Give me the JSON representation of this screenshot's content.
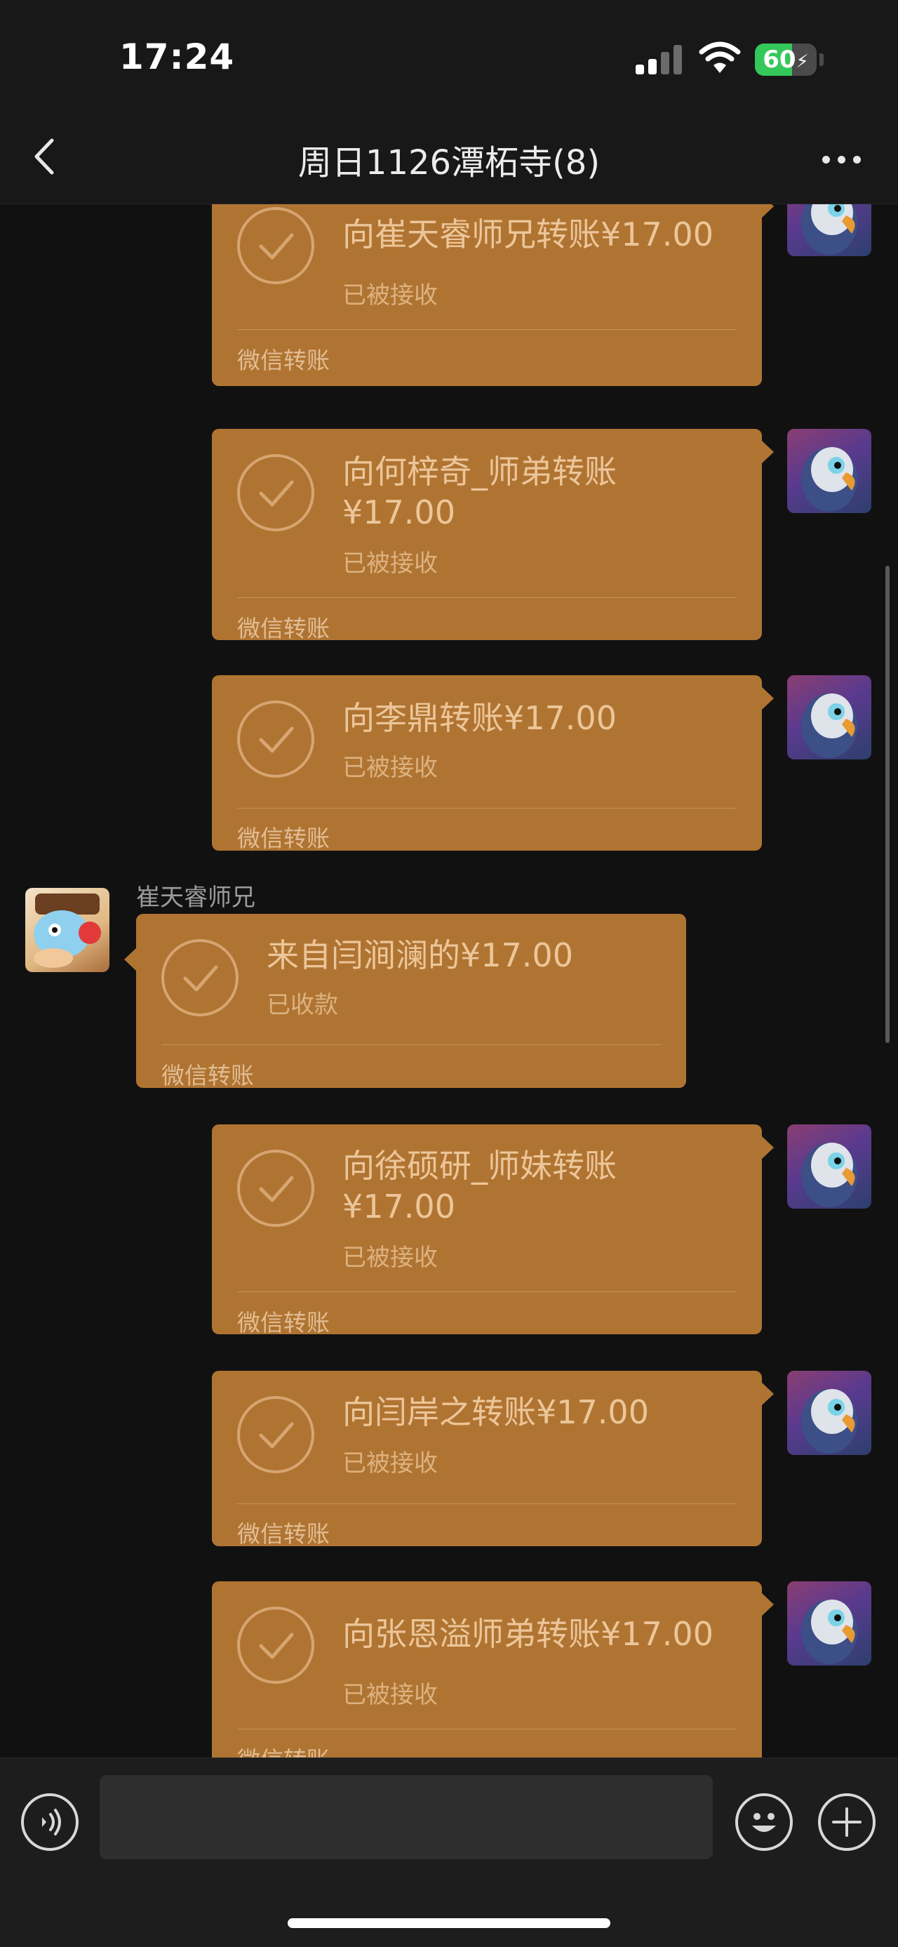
{
  "status_bar": {
    "time": "17:24",
    "battery": "60"
  },
  "nav": {
    "title": "周日1126潭柘寺(8)"
  },
  "messages": [
    {
      "title_line1": "向崔天睿师兄转账¥17.00",
      "title_line2": "",
      "status": "已被接收",
      "footer": "微信转账"
    },
    {
      "title_line1": "向何梓奇_师弟转账",
      "title_line2": "¥17.00",
      "status": "已被接收",
      "footer": "微信转账"
    },
    {
      "title_line1": "向李鼎转账¥17.00",
      "title_line2": "",
      "status": "已被接收",
      "footer": "微信转账"
    },
    {
      "sender_name": "崔天睿师兄",
      "title_line1": "来自闫涧澜的¥17.00",
      "title_line2": "",
      "status": "已收款",
      "footer": "微信转账"
    },
    {
      "title_line1": "向徐硕研_师妹转账",
      "title_line2": "¥17.00",
      "status": "已被接收",
      "footer": "微信转账"
    },
    {
      "title_line1": "向闫岸之转账¥17.00",
      "title_line2": "",
      "status": "已被接收",
      "footer": "微信转账"
    },
    {
      "title_line1": "向张恩溢师弟转账¥17.00",
      "title_line2": "",
      "status": "已被接收",
      "footer": "微信转账"
    }
  ],
  "input_bar": {
    "text_value": ""
  },
  "colors": {
    "bubble": "#b07432",
    "background": "#111111",
    "bar": "#181818",
    "battery_green": "#34c759"
  },
  "icons": [
    "back-arrow-icon",
    "more-dots-icon",
    "check-icon",
    "voice-icon",
    "emoji-icon",
    "plus-icon",
    "signal-icon",
    "wifi-icon",
    "battery-icon"
  ]
}
